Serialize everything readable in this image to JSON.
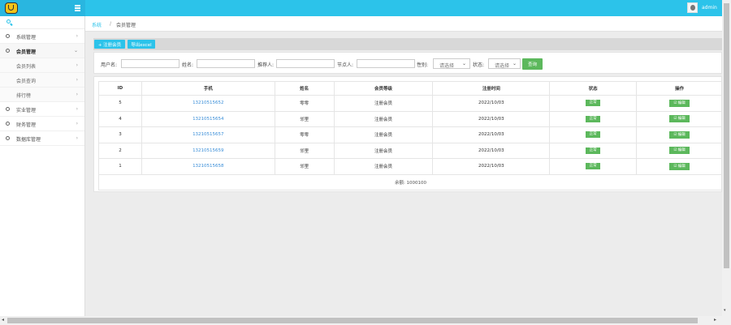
{
  "header": {
    "username": "admin"
  },
  "breadcrumb": {
    "home": "系统",
    "separator": "/",
    "current": "会员管理"
  },
  "sidebar": {
    "items": [
      {
        "label": "系统管理",
        "arrow": "›"
      },
      {
        "label": "会员管理",
        "arrow": "⌄"
      },
      {
        "label": "实业管理",
        "arrow": "›"
      },
      {
        "label": "财务管理",
        "arrow": "›"
      },
      {
        "label": "数据库管理",
        "arrow": "›"
      }
    ],
    "subitems": [
      {
        "label": "会员列表",
        "arrow": "›"
      },
      {
        "label": "会员查询",
        "arrow": "›"
      },
      {
        "label": "排行榜",
        "arrow": "›"
      }
    ]
  },
  "toolbar": {
    "add_label": "+ 注册会员",
    "export_label": "导出excel"
  },
  "filter": {
    "username_label": "用户名:",
    "name_label": "姓名:",
    "referrer_label": "推荐人:",
    "node_label": "节点人:",
    "gender_label": "性别:",
    "gender_value": "请选择",
    "status_label": "状态:",
    "status_value": "请选择",
    "caret": "⌄",
    "query_label": "查询"
  },
  "table": {
    "headers": [
      "ID",
      "手机",
      "姓名",
      "会员等级",
      "注册时间",
      "状态",
      "操作"
    ],
    "rows": [
      {
        "id": "5",
        "phone": "13210515652",
        "name": "零零",
        "level": "注册会员",
        "date": "2022/10/03",
        "status": "正常",
        "action": "☑ 编辑"
      },
      {
        "id": "4",
        "phone": "13210515654",
        "name": "邻里",
        "level": "注册会员",
        "date": "2022/10/03",
        "status": "正常",
        "action": "☑ 编辑"
      },
      {
        "id": "3",
        "phone": "13210515657",
        "name": "零零",
        "level": "注册会员",
        "date": "2022/10/03",
        "status": "正常",
        "action": "☑ 编辑"
      },
      {
        "id": "2",
        "phone": "13210515659",
        "name": "邻里",
        "level": "注册会员",
        "date": "2022/10/03",
        "status": "正常",
        "action": "☑ 编辑"
      },
      {
        "id": "1",
        "phone": "13210515658",
        "name": "邻里",
        "level": "注册会员",
        "date": "2022/10/03",
        "status": "正常",
        "action": "☑ 编辑"
      }
    ],
    "footer": "余额: 1000100"
  },
  "scrollbars": {
    "left": "◂",
    "right": "▸",
    "down": "▾"
  },
  "colors": {
    "accent": "#2cc3ea",
    "success": "#5cb85c",
    "link": "#3a8ed8"
  }
}
